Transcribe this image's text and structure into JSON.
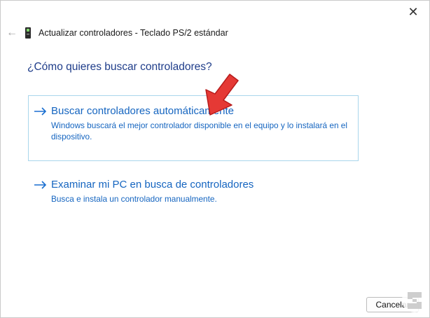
{
  "window": {
    "title": "Actualizar controladores - Teclado PS/2 estándar",
    "back_icon": "back-arrow-icon",
    "device_icon": "device-icon",
    "close_icon": "close-icon"
  },
  "main": {
    "question": "¿Cómo quieres buscar controladores?",
    "options": [
      {
        "title": "Buscar controladores automáticamente",
        "description_line1": "Windows buscará el mejor controlador disponible en el equipo y lo instalará en el",
        "description_line2": "dispositivo.",
        "icon": "arrow-right-icon"
      },
      {
        "title": "Examinar mi PC en busca de controladores",
        "description_line1": "Busca e instala un controlador manualmente.",
        "icon": "arrow-right-icon"
      }
    ]
  },
  "footer": {
    "cancel_label": "Cancelar"
  },
  "colors": {
    "link": "#1565c0",
    "question": "#1f3d8a",
    "focus_border": "#a9d6ec",
    "annotation": "#e53935"
  }
}
